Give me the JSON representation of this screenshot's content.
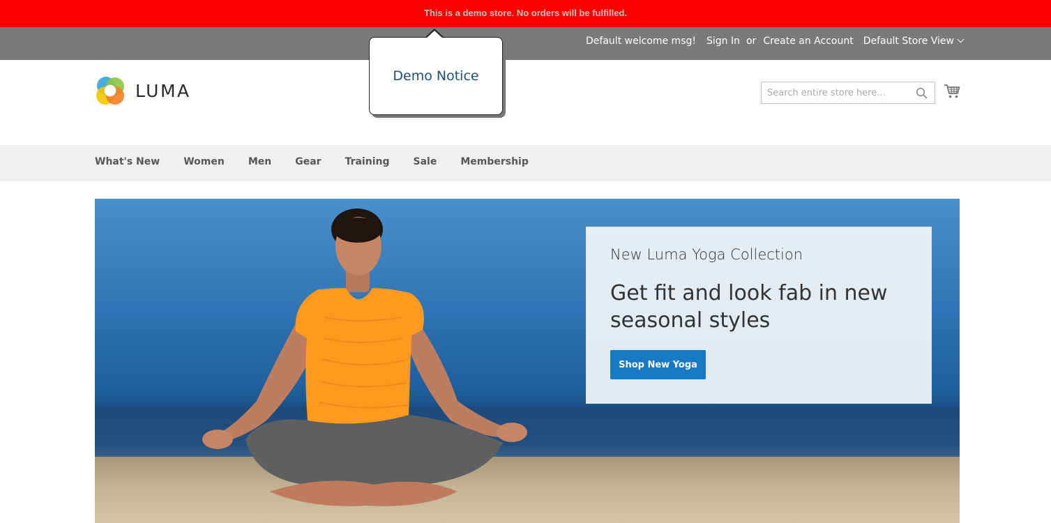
{
  "demo_notice_bar": {
    "text": "This is a demo store. No orders will be fulfilled."
  },
  "panel": {
    "welcome": "Default welcome msg!",
    "sign_in": "Sign In",
    "or": "or",
    "create_account": "Create an Account",
    "store_view": "Default Store View"
  },
  "tooltip": {
    "text": "Demo Notice"
  },
  "logo": {
    "text": "LUMA",
    "colors": [
      "#3fa9dd",
      "#8cc63f",
      "#f5c400",
      "#f48024"
    ]
  },
  "search": {
    "placeholder": "Search entire store here...",
    "value": ""
  },
  "icons": {
    "search": "search-icon",
    "cart": "cart-icon",
    "store_view_chevron": "chevron-down-icon"
  },
  "nav": {
    "items": [
      {
        "label": "What's New"
      },
      {
        "label": "Women"
      },
      {
        "label": "Men"
      },
      {
        "label": "Gear"
      },
      {
        "label": "Training"
      },
      {
        "label": "Sale"
      },
      {
        "label": "Membership"
      }
    ]
  },
  "hero": {
    "subtitle": "New Luma Yoga Collection",
    "title": "Get fit and look fab in new seasonal styles",
    "button": "Shop New Yoga",
    "button_color": "#1979c3"
  },
  "colors": {
    "demo_bar": "#ff0000",
    "panel": "#7a7b79",
    "nav_bg": "#f0f0f0"
  }
}
